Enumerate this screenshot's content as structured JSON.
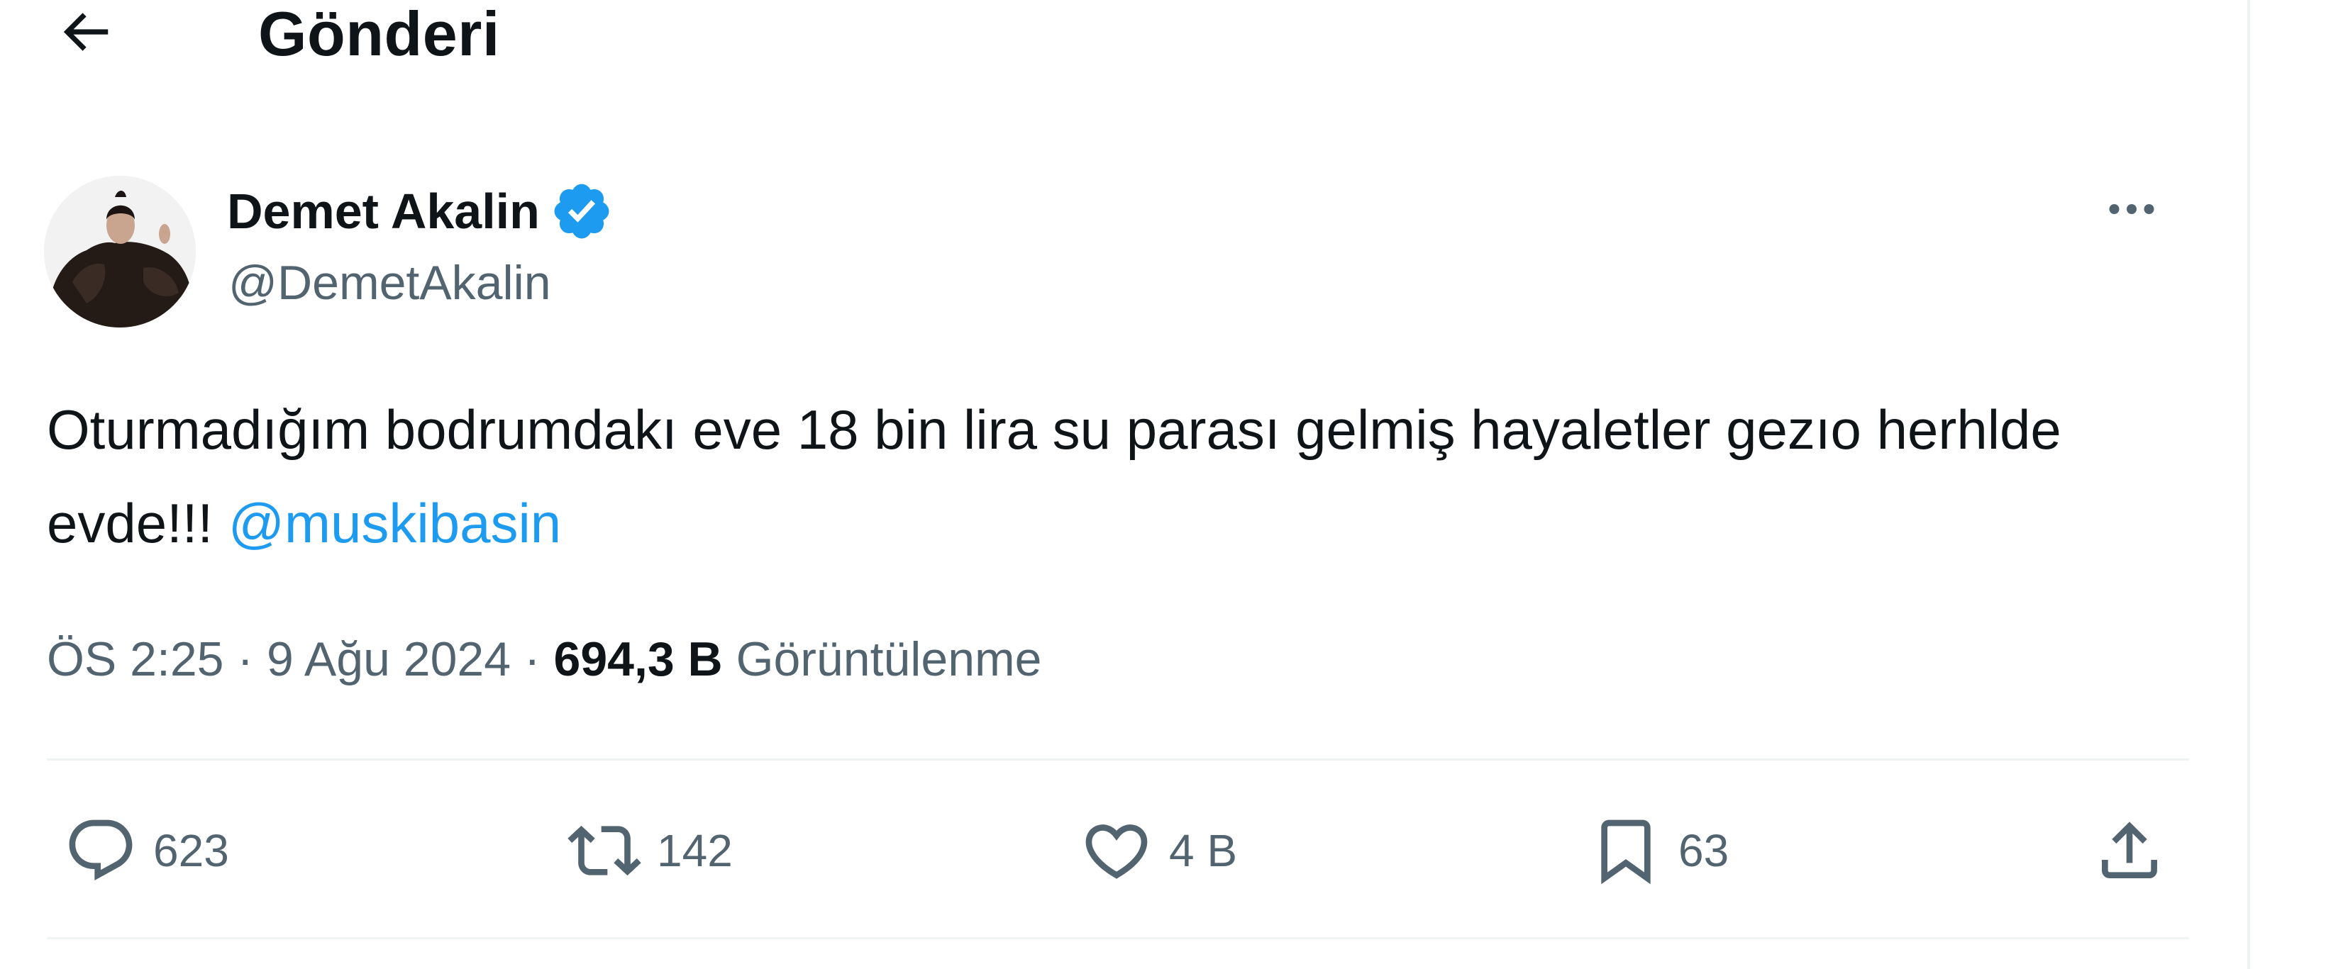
{
  "header": {
    "back_icon": "arrow-left-icon",
    "title": "Gönderi"
  },
  "tweet": {
    "author": {
      "name": "Demet Akalin",
      "handle": "@DemetAkalin",
      "verified_icon": "verified-badge-icon"
    },
    "text_main": "Oturmadığım bodrumdakı eve 18 bin lira su parası gelmiş hayaletler gezıo herhlde evde!!! ",
    "mention": "@muskibasin",
    "time": "ÖS 2:25",
    "separator": " · ",
    "date": "9 Ağu 2024",
    "views_count": "694,3 B",
    "views_label": "Görüntülenme"
  },
  "actions": {
    "replies": "623",
    "reposts": "142",
    "likes": "4 B",
    "bookmarks": "63"
  },
  "colors": {
    "accent": "#1d9bf0",
    "text": "#0f1419",
    "secondary": "#536471",
    "divider": "#eff3f4"
  }
}
